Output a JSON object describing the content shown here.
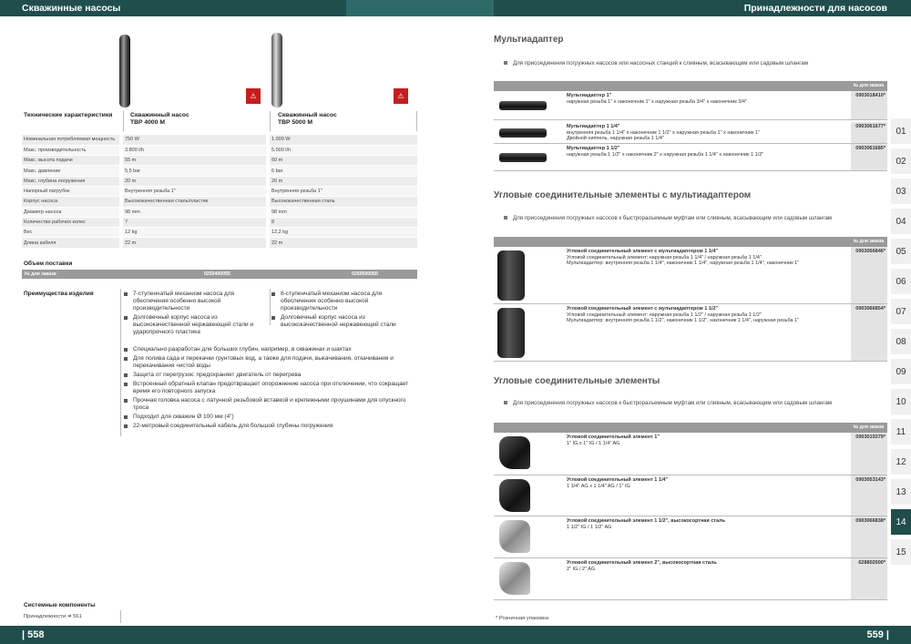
{
  "header": {
    "left_title": "Скважинные насосы",
    "right_title": "Принадлежности для насосов"
  },
  "footer": {
    "left_page": "| 558",
    "right_page": "559 |"
  },
  "left": {
    "pump_a_title": "Скважинный насос\nTBP 4000 M",
    "pump_b_title": "Скважинный насос\nTBP 5000 M",
    "tech_header": "Технические характеристики",
    "specs": [
      {
        "label": "Номинальная потребляемая мощность",
        "a": "750 W",
        "b": "1.000 W"
      },
      {
        "label": "Макс. производительность",
        "a": "3.800 l/h",
        "b": "5.000 l/h"
      },
      {
        "label": "Макс. высота подачи",
        "a": "55 m",
        "b": "60 m"
      },
      {
        "label": "Макс. давление",
        "a": "5,5 bar",
        "b": "6 bar"
      },
      {
        "label": "Макс. глубина погружения",
        "a": "20 m",
        "b": "20 m"
      },
      {
        "label": "Напорный патрубок",
        "a": "Внутренняя резьба 1\"",
        "b": "Внутренняя резьба 1\""
      },
      {
        "label": "Корпус насоса",
        "a": "Высококачественная сталь/пластик",
        "b": "Высококачественная сталь"
      },
      {
        "label": "Диаметр насоса",
        "a": "98 mm",
        "b": "98 mm"
      },
      {
        "label": "Количество рабочих колес",
        "a": "7",
        "b": "8"
      },
      {
        "label": "Вес",
        "a": "12 kg",
        "b": "12,2 kg"
      },
      {
        "label": "Длина кабеля",
        "a": "22 m",
        "b": "22 m"
      }
    ],
    "scope_label": "Объем поставки",
    "order_label": "№ для заказа",
    "order_a": "0250400055",
    "order_b": "0250500050",
    "advantages_label": "Преимущества изделия",
    "adv_a": [
      "7-ступенчатый механизм насоса для обеспечения особенно высокой производительности",
      "Долговечный корпус насоса из высококачественной нержавеющей стали и ударопрочного пластика"
    ],
    "adv_b": [
      "8-ступенчатый механизм насоса для обеспечения особенно высокой производительности",
      "Долговечный корпус насоса из высококачественной нержавеющей стали"
    ],
    "adv_common": [
      "Специально разработан для больших глубин, например, в скважинах и шахтах",
      "Для полива сада и перекачки грунтовых вод, а также для подачи, выкачивания, откачивания и перекачивания чистой воды",
      "Защита от перегрузок: предохраняет двигатель от перегрева",
      "Встроенный обратный клапан предотвращает опорожнение насоса при отключении, что сокращает время его повторного запуска",
      "Прочная головка насоса с латунной резьбовой вставкой и крепежными проушинами для опускного троса",
      "Подходит для скважин Ø 100 мм (4\")",
      "22-метровый соединительный кабель для большой глубины погружения"
    ],
    "system_label": "Системные компоненты",
    "system_item": "Принадлежности ➜ 561"
  },
  "right": {
    "order_header": "№ для заказа",
    "sec1": {
      "title": "Мультиадаптер",
      "note": "Для присоединения погружных насосов или насосных станций к сливным, всасывающим или садовым шлангам",
      "items": [
        {
          "name": "Мультиадаптер 1\"",
          "desc": "наружная резьба 1\" x наконечник 1\" x наружная резьба 3/4\" x наконечник 3/4\"",
          "code": "0903018410*"
        },
        {
          "name": "Мультиадаптер 1 1/4\"",
          "desc": "внутренняя резьба 1 1/4\" x наконечник 1 1/2\" x наружная резьба 1\" x наконечник 1\"\nДвойной ниппель, наружная резьба 1 1/4\"",
          "code": "0903061677*"
        },
        {
          "name": "Мультиадаптер 1 1/2\"",
          "desc": "наружная резьба 1 1/2\" x наконечник 2\" x наружная резьба 1 1/4\" x наконечник 1 1/2\"",
          "code": "0903061685*"
        }
      ]
    },
    "sec2": {
      "title": "Угловые соединительные элементы с мультиадаптером",
      "note": "Для присоединения погружных насосов к быстроразъемным муфтам или сливным, всасывающим или садовым шлангам",
      "items": [
        {
          "name": "Угловой соединительный элемент с мультиадаптером 1 1/4\"",
          "desc": "Угловой соединительный элемент: наружная резьба 1 1/4\" / наружная резьба 1 1/4\"\nМультиадаптер: внутренняя резьба 1 1/4\", наконечник 1 1/4\", наружная резьба 1 1/4\", наконечник 1\"",
          "code": "0903066846*"
        },
        {
          "name": "Угловой соединительный элемент с мультиадаптером 1 1/2\"",
          "desc": "Угловой соединительный элемент: наружная резьба 1 1/2\" / наружная резьба 1 1/2\"\nМультиадаптер: внутренняя резьба 1 1/2\", наконечник 1 1/2\", наконечник 1 1/4\", наружная резьба 1\"",
          "code": "0903066854*"
        }
      ]
    },
    "sec3": {
      "title": "Угловые соединительные элементы",
      "note": "Для присоединения погружных насосов к быстроразъемным муфтам или сливным, всасывающим или садовым шлангам",
      "items": [
        {
          "name": "Угловой соединительный элемент 1\"",
          "desc": "1\" IG x 1\" IG / 1 1/4\" AG",
          "code": "0903019379*"
        },
        {
          "name": "Угловой соединительный элемент 1 1/4\"",
          "desc": "1 1/4\" AG x 1 1/4\" AG / 1\" IG",
          "code": "0903053143*"
        },
        {
          "name": "Угловой соединительный элемент 1 1/2\", высокосортная сталь",
          "desc": "1 1/2\" IG / 1 1/2\" AG",
          "code": "0903066838*"
        },
        {
          "name": "Угловой соединительный элемент 2\", высокосортная сталь",
          "desc": "2\" IG / 2\" AG",
          "code": "628802000*"
        }
      ]
    },
    "footnote": "* Розничная упаковка"
  },
  "tabs": [
    "01",
    "02",
    "03",
    "04",
    "05",
    "06",
    "07",
    "08",
    "09",
    "10",
    "11",
    "12",
    "13",
    "14",
    "15"
  ],
  "active_tab": "14",
  "colors": {
    "brand": "#1f4e4d",
    "warning": "#c41e1e",
    "grey_header": "#9a9a9a"
  }
}
